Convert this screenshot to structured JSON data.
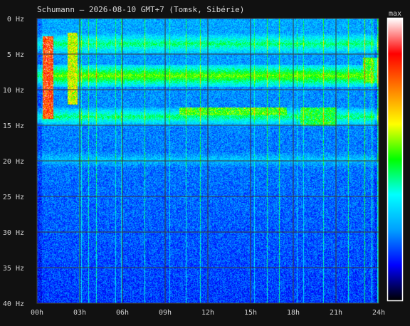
{
  "chart_data": {
    "type": "heatmap",
    "title": "Schumann — 2026-08-10 GMT+7  (Tomsk, Sibérie)",
    "x_ticks": [
      "00h",
      "03h",
      "06h",
      "09h",
      "12h",
      "15h",
      "18h",
      "21h",
      "24h"
    ],
    "y_ticks": [
      "0 Hz",
      "5 Hz",
      "10 Hz",
      "15 Hz",
      "20 Hz",
      "25 Hz",
      "30 Hz",
      "35 Hz",
      "40 Hz"
    ],
    "x_range_hours": [
      0,
      24
    ],
    "y_range_hz": [
      0,
      40
    ],
    "grid": true,
    "colorbar_label": "max",
    "colormap": [
      "#000000",
      "#0000ff",
      "#00a0ff",
      "#00ffff",
      "#00ff00",
      "#ffff00",
      "#ff8000",
      "#ff0000",
      "#ffffff"
    ],
    "bands_hz": [
      {
        "from_hz": 6.5,
        "to_hz": 9.5,
        "level": 0.55
      },
      {
        "from_hz": 12.5,
        "to_hz": 15.0,
        "level": 0.45
      },
      {
        "from_hz": 18.0,
        "to_hz": 21.5,
        "level": 0.3
      },
      {
        "from_hz": 2.0,
        "to_hz": 5.0,
        "level": 0.45
      }
    ],
    "hot_spots": [
      {
        "from_h": 0.4,
        "to_h": 1.1,
        "from_hz": 2.5,
        "to_hz": 14.0,
        "level": 0.95
      },
      {
        "from_h": 2.1,
        "to_h": 2.8,
        "from_hz": 2.0,
        "to_hz": 12.0,
        "level": 0.7
      },
      {
        "from_h": 18.5,
        "to_h": 21.0,
        "from_hz": 12.5,
        "to_hz": 15.0,
        "level": 0.55
      },
      {
        "from_h": 10.0,
        "to_h": 17.5,
        "from_hz": 12.5,
        "to_hz": 13.5,
        "level": 0.6
      },
      {
        "from_h": 22.9,
        "to_h": 24.0,
        "from_hz": 5.5,
        "to_hz": 9.0,
        "level": 0.6
      }
    ]
  }
}
